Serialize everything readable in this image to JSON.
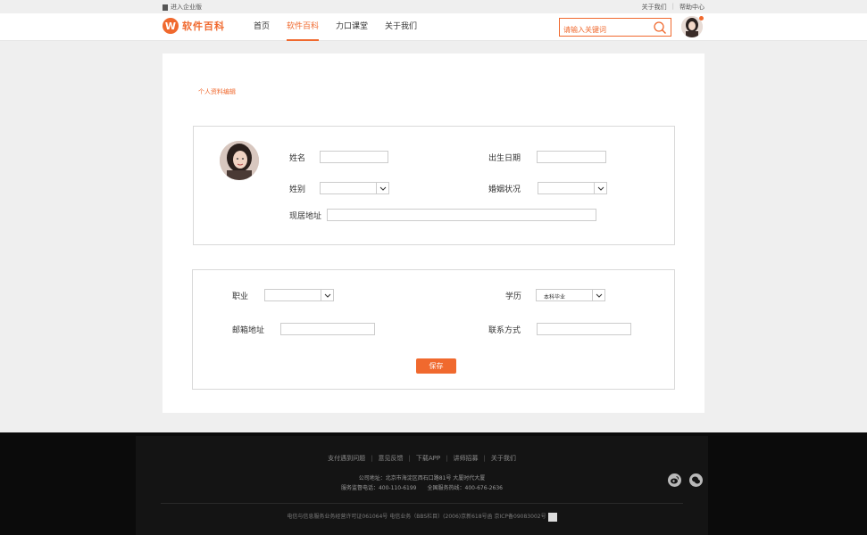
{
  "topbar": {
    "enterprise": "进入企业版",
    "about": "关于我们",
    "help": "帮助中心"
  },
  "header": {
    "logo_mark": "W",
    "logo_text": "软件百科",
    "nav": [
      {
        "label": "首页"
      },
      {
        "label": "软件百科"
      },
      {
        "label": "力口课堂"
      },
      {
        "label": "关于我们"
      }
    ],
    "search_placeholder": "请输入关键词"
  },
  "breadcrumb": "个人资料编辑",
  "profile": {
    "name_label": "姓名",
    "birth_label": "出生日期",
    "gender_label": "姓别",
    "marital_label": "婚姻状况",
    "address_label": "现居地址"
  },
  "career": {
    "job_label": "职业",
    "education_label": "学历",
    "education_value": "本科毕业",
    "email_label": "邮箱地址",
    "contact_label": "联系方式",
    "save": "保存"
  },
  "footer": {
    "links": [
      "支付遇到问题",
      "意见反馈",
      "下载APP",
      "讲师招募",
      "关于我们"
    ],
    "address": "公司地址：北京市海淀区西石口路81号 大厦时代大厦",
    "service_phone": "服务监督电话：400-110-6199",
    "hotline": "全国服务热线：400-676-2636",
    "license": "电信与信息服务业务经营许可证061064号 电信业务（BBS栏目）(2006)京新618号函 京ICP备09083002号"
  },
  "colors": {
    "accent": "#f0692e",
    "footer_bg": "#0b0b0b"
  }
}
